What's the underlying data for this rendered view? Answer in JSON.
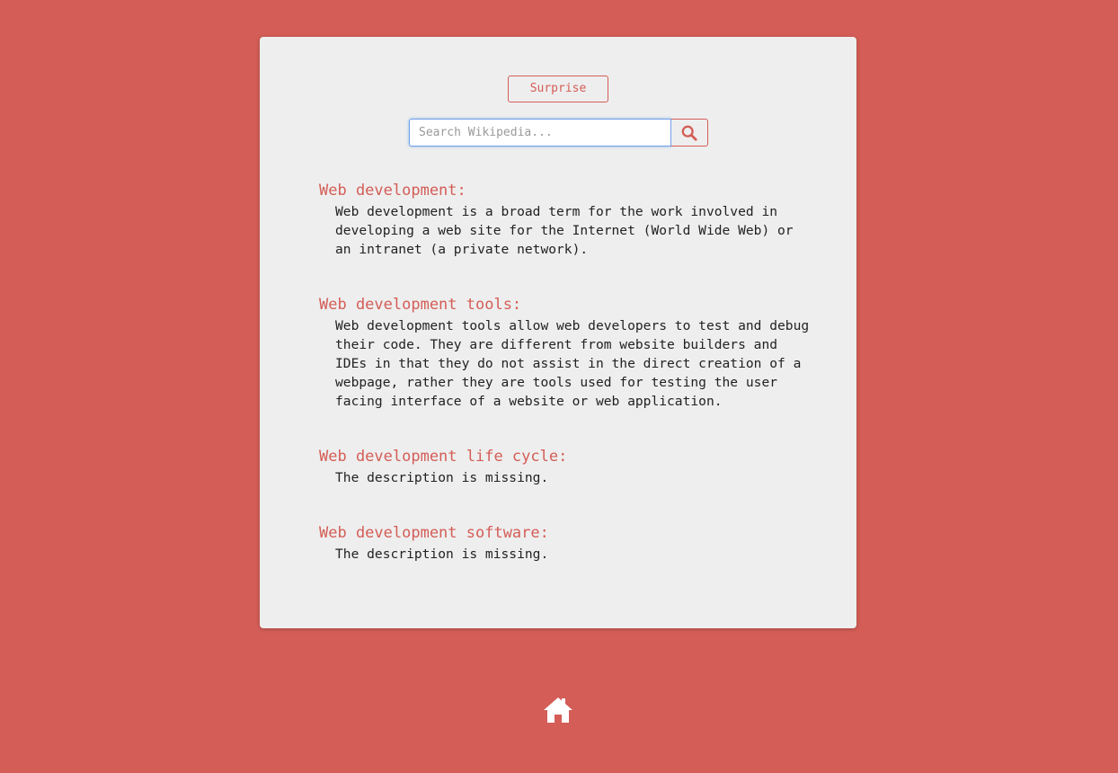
{
  "surprise_label": "Surprise",
  "search": {
    "placeholder": "Search Wikipedia...",
    "value": ""
  },
  "results": [
    {
      "title": "Web development:",
      "description": "Web development is a broad term for the work involved in developing a web site for the Internet (World Wide Web) or an intranet (a private network)."
    },
    {
      "title": "Web development tools:",
      "description": "Web development tools allow web developers to test and debug their code. They are different from website builders and IDEs in that they do not assist in the direct creation of a webpage, rather they are tools used for testing the user facing interface of a website or web application."
    },
    {
      "title": "Web development life cycle:",
      "description": "The description is missing."
    },
    {
      "title": "Web development software:",
      "description": "The description is missing."
    }
  ],
  "icons": {
    "search": "search-icon",
    "home": "home-icon"
  },
  "colors": {
    "background": "#d45d57",
    "card": "#eeeeee",
    "accent": "#d45d57",
    "text": "#222222"
  }
}
